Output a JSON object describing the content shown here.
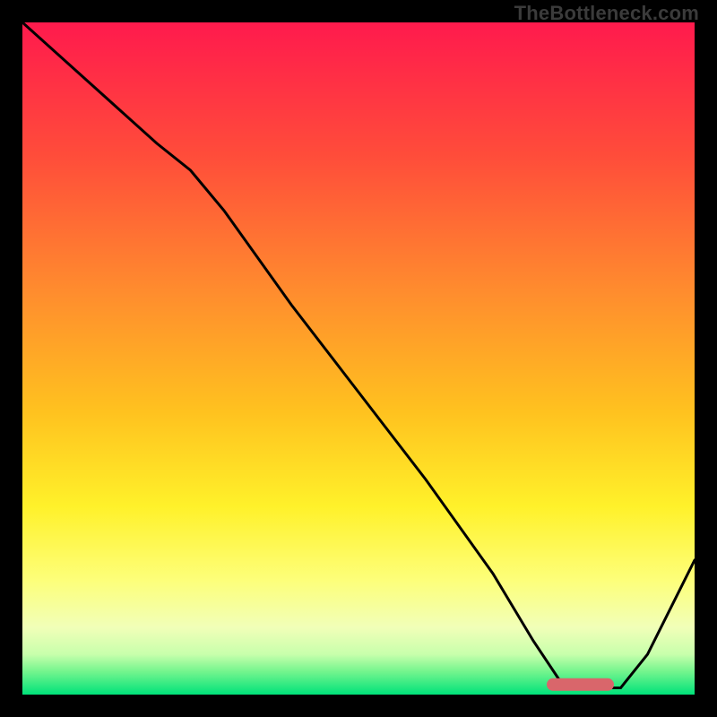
{
  "watermark": "TheBottleneck.com",
  "gradient_stops": [
    {
      "offset": 0.0,
      "color": "#ff1a4d"
    },
    {
      "offset": 0.2,
      "color": "#ff4d3a"
    },
    {
      "offset": 0.4,
      "color": "#ff8c2e"
    },
    {
      "offset": 0.58,
      "color": "#ffc21f"
    },
    {
      "offset": 0.72,
      "color": "#fff12a"
    },
    {
      "offset": 0.83,
      "color": "#fdff7a"
    },
    {
      "offset": 0.9,
      "color": "#f1ffb8"
    },
    {
      "offset": 0.94,
      "color": "#c8ffac"
    },
    {
      "offset": 0.965,
      "color": "#76f58e"
    },
    {
      "offset": 1.0,
      "color": "#00e27a"
    }
  ],
  "zone_marker": {
    "color": "#d9666b",
    "x_start": 0.78,
    "x_end": 0.88,
    "y": 0.985,
    "thickness": 14,
    "radius": 7
  },
  "chart_data": {
    "type": "line",
    "title": "",
    "xlabel": "",
    "ylabel": "",
    "xlim": [
      0,
      1
    ],
    "ylim": [
      0,
      1
    ],
    "series": [
      {
        "name": "bottleneck-curve",
        "x": [
          0.0,
          0.1,
          0.2,
          0.25,
          0.3,
          0.4,
          0.5,
          0.6,
          0.7,
          0.76,
          0.8,
          0.85,
          0.89,
          0.93,
          1.0
        ],
        "y": [
          1.0,
          0.91,
          0.82,
          0.78,
          0.72,
          0.58,
          0.45,
          0.32,
          0.18,
          0.08,
          0.02,
          0.01,
          0.01,
          0.06,
          0.2
        ]
      }
    ],
    "optimal_zone_x": [
      0.78,
      0.88
    ]
  }
}
